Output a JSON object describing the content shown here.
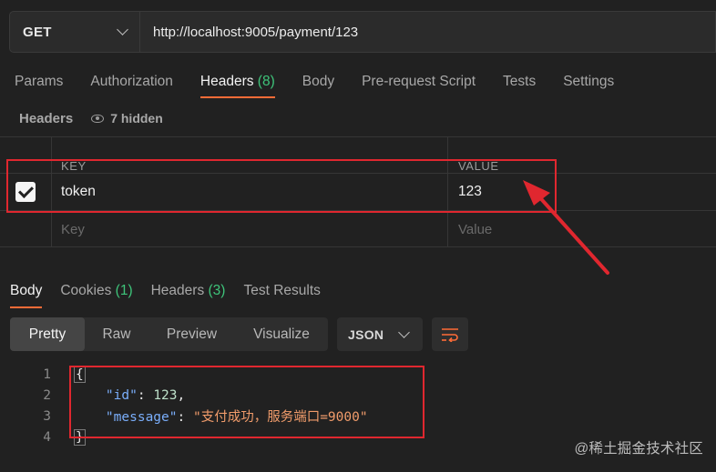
{
  "request": {
    "method": "GET",
    "url": "http://localhost:9005/payment/123"
  },
  "request_tabs": [
    {
      "label": "Params",
      "count": ""
    },
    {
      "label": "Authorization",
      "count": ""
    },
    {
      "label": "Headers",
      "count": "(8)"
    },
    {
      "label": "Body",
      "count": ""
    },
    {
      "label": "Pre-request Script",
      "count": ""
    },
    {
      "label": "Tests",
      "count": ""
    },
    {
      "label": "Settings",
      "count": ""
    }
  ],
  "active_request_tab": "Headers",
  "headers_panel": {
    "title": "Headers",
    "hidden_label": "7 hidden",
    "columns": {
      "key": "KEY",
      "value": "VALUE"
    },
    "rows": [
      {
        "key": "token",
        "value": "123",
        "checked": true
      }
    ],
    "placeholder": {
      "key": "Key",
      "value": "Value"
    }
  },
  "response_tabs": [
    {
      "label": "Body",
      "count": ""
    },
    {
      "label": "Cookies",
      "count": "(1)"
    },
    {
      "label": "Headers",
      "count": "(3)"
    },
    {
      "label": "Test Results",
      "count": ""
    }
  ],
  "view_modes": [
    "Pretty",
    "Raw",
    "Preview",
    "Visualize"
  ],
  "active_view_mode": "Pretty",
  "format": "JSON",
  "code": {
    "line_numbers": [
      "1",
      "2",
      "3",
      "4"
    ],
    "open_brace": "{",
    "close_brace": "}",
    "id_key": "\"id\"",
    "id_value": "123",
    "message_key": "\"message\"",
    "message_value": "\"支付成功，服务端口=9000\""
  },
  "watermark": "@稀土掘金技术社区",
  "colors": {
    "accent": "#ff6c37",
    "count_green": "#3ec47a",
    "annotation_red": "#e0272f",
    "json_key": "#7aaefb",
    "json_string": "#f19c6b"
  }
}
